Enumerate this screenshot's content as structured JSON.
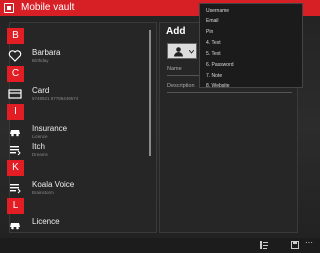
{
  "window": {
    "title": "Mobile vault"
  },
  "list": {
    "rows": [
      {
        "kind": "letter",
        "letter": "B"
      },
      {
        "kind": "entry",
        "icon": "heart-icon",
        "title": "Barbara",
        "subtitle": "Birthday"
      },
      {
        "kind": "letter",
        "letter": "C"
      },
      {
        "kind": "entry",
        "icon": "card-icon",
        "title": "Card",
        "subtitle": "5748921 87789449574"
      },
      {
        "kind": "letter",
        "letter": "I"
      },
      {
        "kind": "entry",
        "icon": "car-icon",
        "title": "Insurance",
        "subtitle": "Licence"
      },
      {
        "kind": "entry",
        "icon": "list-icon",
        "title": "Itch",
        "subtitle": "Dreams"
      },
      {
        "kind": "letter",
        "letter": "K"
      },
      {
        "kind": "entry",
        "icon": "list-icon",
        "title": "Koala Voice",
        "subtitle": "Brainstorm"
      },
      {
        "kind": "letter",
        "letter": "L"
      },
      {
        "kind": "entry",
        "icon": "car-icon",
        "title": "Licence",
        "subtitle": ""
      }
    ]
  },
  "add_panel": {
    "title": "Add",
    "name_label": "Name",
    "description_label": "Description"
  },
  "field_type_menu": {
    "options": [
      "Username",
      "Email",
      "Pin",
      "4. Text",
      "5. Text",
      "6. Password",
      "7. Note",
      "8. Website"
    ]
  },
  "colors": {
    "accent": "#e21d24",
    "titlebar": "#d71f26"
  }
}
